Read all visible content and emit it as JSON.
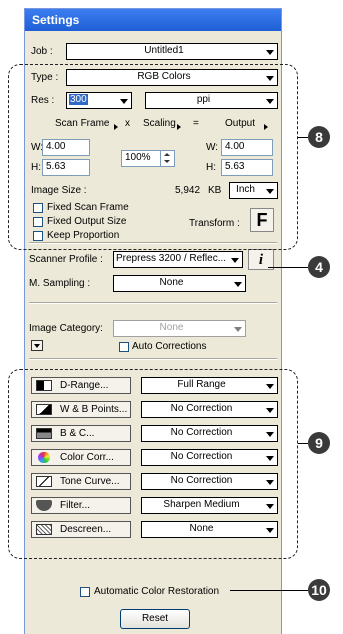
{
  "title": "Settings",
  "job": {
    "label": "Job :",
    "value": "Untitled1"
  },
  "type": {
    "label": "Type :",
    "value": "RGB Colors"
  },
  "res": {
    "label": "Res :",
    "value": "300",
    "unit": "ppi"
  },
  "headers": {
    "scan_frame": "Scan Frame",
    "x": "x",
    "scaling": "Scaling",
    "eq": "=",
    "output": "Output"
  },
  "scan": {
    "w_label": "W:",
    "w_value": "4.00",
    "h_label": "H:",
    "h_value": "5.63"
  },
  "scaling_value": "100%",
  "output": {
    "w_label": "W:",
    "w_value": "4.00",
    "h_label": "H:",
    "h_value": "5.63"
  },
  "image_size": {
    "label": "Image Size :",
    "value": "5,942",
    "unit": "KB",
    "dim_unit": "Inch"
  },
  "checks": {
    "fixed_scan_frame": "Fixed Scan Frame",
    "fixed_output_size": "Fixed Output Size",
    "keep_proportion": "Keep Proportion"
  },
  "transform": {
    "label": "Transform :",
    "glyph": "F"
  },
  "scanner_profile": {
    "label": "Scanner Profile :",
    "value": "Prepress 3200 / Reflec...",
    "info": "i"
  },
  "m_sampling": {
    "label": "M. Sampling :",
    "value": "None"
  },
  "image_category": {
    "label": "Image Category:",
    "value": "None"
  },
  "auto_corrections": "Auto Corrections",
  "tools": [
    {
      "label": "D-Range...",
      "value": "Full Range"
    },
    {
      "label": "W & B Points...",
      "value": "No Correction"
    },
    {
      "label": "B & C...",
      "value": "No Correction"
    },
    {
      "label": "Color Corr...",
      "value": "No Correction"
    },
    {
      "label": "Tone Curve...",
      "value": "No Correction"
    },
    {
      "label": "Filter...",
      "value": "Sharpen Medium"
    },
    {
      "label": "Descreen...",
      "value": "None"
    }
  ],
  "auto_color_restoration": "Automatic Color Restoration",
  "reset": "Reset",
  "callouts": [
    "8",
    "4",
    "9",
    "10"
  ],
  "colors": {
    "title_bar": "#2a6ae6",
    "panel": "#ece9d8",
    "selection": "#316ac5"
  }
}
